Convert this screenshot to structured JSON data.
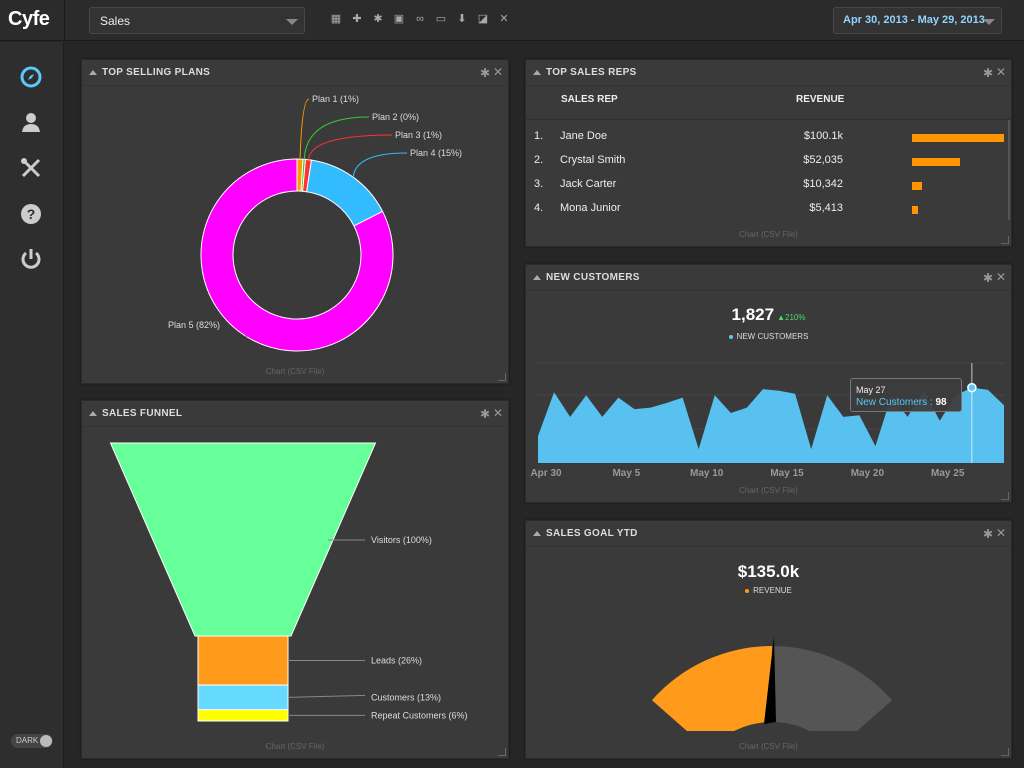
{
  "app": {
    "logo": "Cyfe"
  },
  "topbar": {
    "dashboard": "Sales",
    "date_range": "Apr 30, 2013 - May 29, 2013",
    "tools": [
      "grid-icon",
      "plus-icon",
      "gear-icon",
      "image-icon",
      "link-icon",
      "monitor-icon",
      "download-icon",
      "share-icon",
      "close-icon"
    ]
  },
  "sidebar": {
    "items": [
      "compass-icon",
      "user-icon",
      "tools-icon",
      "help-icon",
      "power-icon"
    ],
    "toggle": "DARK"
  },
  "panels": {
    "top_selling_plans": {
      "title": "TOP SELLING PLANS",
      "source": "Chart (CSV File)"
    },
    "sales_funnel": {
      "title": "SALES FUNNEL",
      "source": "Chart (CSV File)"
    },
    "top_sales_reps": {
      "title": "TOP SALES REPS",
      "col_rep": "SALES REP",
      "col_revenue": "REVENUE",
      "source": "Chart (CSV File)",
      "rows": [
        {
          "num": "1.",
          "name": "Jane Doe",
          "revenue": "$100.1k",
          "value": 100.1
        },
        {
          "num": "2.",
          "name": "Crystal Smith",
          "revenue": "$52,035",
          "value": 52.035
        },
        {
          "num": "3.",
          "name": "Jack Carter",
          "revenue": "$10,342",
          "value": 10.342
        },
        {
          "num": "4.",
          "name": "Mona Junior",
          "revenue": "$5,413",
          "value": 5.413
        }
      ]
    },
    "new_customers": {
      "title": "NEW CUSTOMERS",
      "value": "1,827",
      "change": "▲210%",
      "legend": "NEW CUSTOMERS",
      "source": "Chart (CSV File)",
      "tooltip_date": "May 27",
      "tooltip_label": "New Customers : ",
      "tooltip_value": "98"
    },
    "sales_goal": {
      "title": "SALES GOAL YTD",
      "value": "$135.0k",
      "legend": "REVENUE",
      "source": "Chart (CSV File)"
    }
  },
  "chart_data": [
    {
      "type": "pie",
      "title": "TOP SELLING PLANS",
      "donut": true,
      "categories": [
        "Plan 1",
        "Plan 2",
        "Plan 3",
        "Plan 4",
        "Plan 5"
      ],
      "labels": [
        "Plan 1 (1%)",
        "Plan 2 (0%)",
        "Plan 3 (1%)",
        "Plan 4 (15%)",
        "Plan 5 (82%)"
      ],
      "values": [
        1,
        0.4,
        1,
        15,
        82
      ],
      "colors": [
        "#ff9a00",
        "#33cc33",
        "#ff3333",
        "#33bbff",
        "#ff00ff"
      ]
    },
    {
      "type": "bar",
      "subtype": "funnel",
      "title": "SALES FUNNEL",
      "categories": [
        "Visitors",
        "Leads",
        "Customers",
        "Repeat Customers"
      ],
      "labels": [
        "Visitors (100%)",
        "Leads (26%)",
        "Customers (13%)",
        "Repeat Customers (6%)"
      ],
      "values": [
        100,
        26,
        13,
        6
      ],
      "colors": [
        "#66ff99",
        "#ff9a1a",
        "#66d9ff",
        "#ffff00"
      ]
    },
    {
      "type": "area",
      "title": "NEW CUSTOMERS",
      "x_ticks": [
        "Apr 30",
        "May 5",
        "May 10",
        "May 15",
        "May 20",
        "May 25"
      ],
      "x": [
        "Apr 30",
        "May 1",
        "May 2",
        "May 3",
        "May 4",
        "May 5",
        "May 6",
        "May 7",
        "May 8",
        "May 9",
        "May 10",
        "May 11",
        "May 12",
        "May 13",
        "May 14",
        "May 15",
        "May 16",
        "May 17",
        "May 18",
        "May 19",
        "May 20",
        "May 21",
        "May 22",
        "May 23",
        "May 24",
        "May 25",
        "May 26",
        "May 27",
        "May 28",
        "May 29"
      ],
      "series": [
        {
          "name": "New Customers",
          "values": [
            35,
            92,
            60,
            88,
            60,
            85,
            70,
            72,
            78,
            85,
            18,
            88,
            65,
            72,
            96,
            94,
            90,
            18,
            88,
            60,
            62,
            22,
            88,
            60,
            95,
            55,
            88,
            98,
            95,
            75
          ]
        }
      ],
      "ylim": [
        0,
        130
      ],
      "color": "#5ac8fa"
    },
    {
      "type": "gauge",
      "title": "SALES GOAL YTD",
      "series": [
        {
          "name": "REVENUE",
          "values": [
            135.0
          ]
        }
      ],
      "fill_fraction": 0.5,
      "colors": [
        "#ff9a1a",
        "#555555"
      ]
    }
  ]
}
